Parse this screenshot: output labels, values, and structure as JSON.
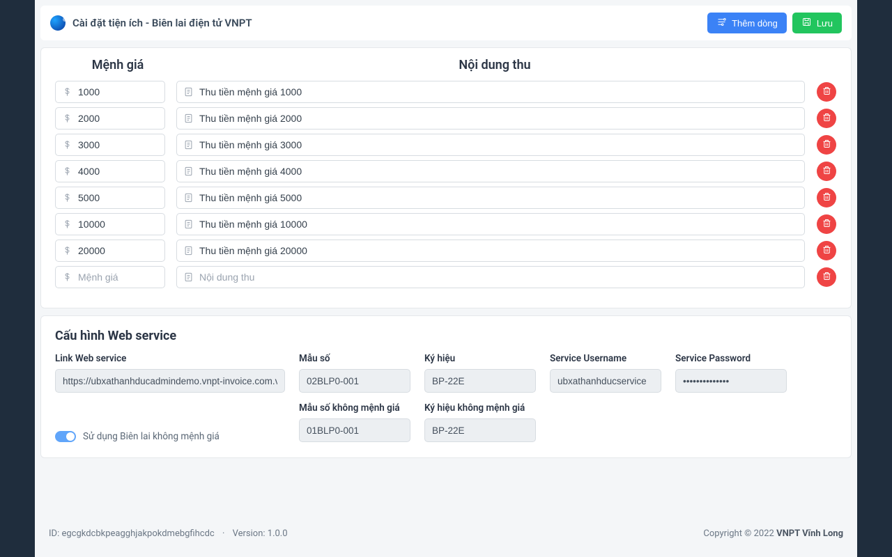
{
  "header": {
    "title": "Cài đặt tiện ích - Biên lai điện tử VNPT",
    "add_row_label": "Thêm dòng",
    "save_label": "Lưu"
  },
  "table": {
    "col_amount_header": "Mệnh giá",
    "col_desc_header": "Nội dung thu",
    "amount_placeholder": "Mệnh giá",
    "desc_placeholder": "Nội dung thu",
    "rows": [
      {
        "amount": "1000",
        "desc": "Thu tiền mệnh giá 1000"
      },
      {
        "amount": "2000",
        "desc": "Thu tiền mệnh giá 2000"
      },
      {
        "amount": "3000",
        "desc": "Thu tiền mệnh giá 3000"
      },
      {
        "amount": "4000",
        "desc": "Thu tiền mệnh giá 4000"
      },
      {
        "amount": "5000",
        "desc": "Thu tiền mệnh giá 5000"
      },
      {
        "amount": "10000",
        "desc": "Thu tiền mệnh giá 10000"
      },
      {
        "amount": "20000",
        "desc": "Thu tiền mệnh giá 20000"
      }
    ]
  },
  "ws": {
    "title": "Cấu hình Web service",
    "link_label": "Link Web service",
    "link_value": "https://ubxathanhducadmindemo.vnpt-invoice.com.vn",
    "pattern_label": "Mẫu số",
    "pattern_value": "02BLP0-001",
    "serial_label": "Ký hiệu",
    "serial_value": "BP-22E",
    "username_label": "Service Username",
    "username_value": "ubxathanhducservice",
    "password_label": "Service Password",
    "password_value": "••••••••••••••",
    "toggle_label": "Sử dụng Biên lai không mệnh giá",
    "pattern0_label": "Mẫu số không mệnh giá",
    "pattern0_value": "01BLP0-001",
    "serial0_label": "Ký hiệu không mệnh giá",
    "serial0_value": "BP-22E"
  },
  "footer": {
    "id_prefix": "ID: ",
    "id_value": "egcgkdcbkpeagghjakpokdmebgfihcdc",
    "version_prefix": "Version: ",
    "version_value": "1.0.0",
    "copyright": "Copyright © 2022 ",
    "brand": "VNPT Vĩnh Long"
  }
}
